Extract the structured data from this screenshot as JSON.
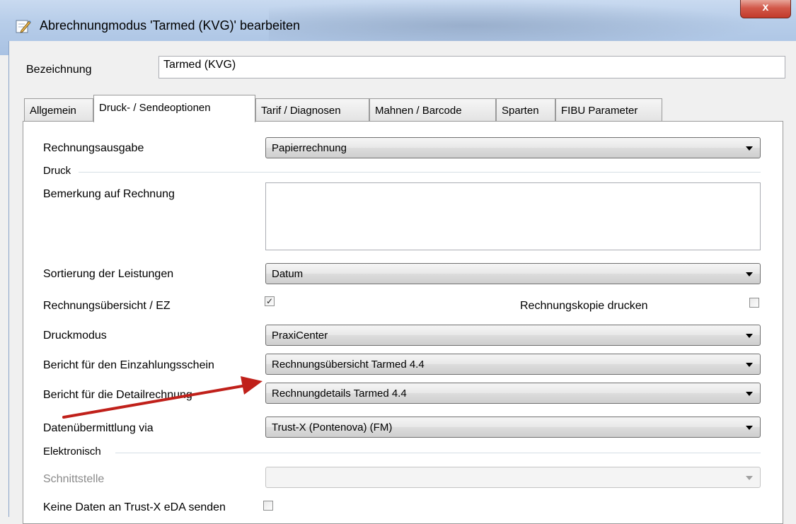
{
  "window": {
    "title": "Abrechnungmodus 'Tarmed (KVG)' bearbeiten",
    "close_label": "x"
  },
  "header": {
    "bezeichnung_label": "Bezeichnung",
    "bezeichnung_value": "Tarmed (KVG)"
  },
  "tabs": [
    {
      "label": "Allgemein"
    },
    {
      "label": "Druck- / Sendeoptionen"
    },
    {
      "label": "Tarif / Diagnosen"
    },
    {
      "label": "Mahnen / Barcode"
    },
    {
      "label": "Sparten"
    },
    {
      "label": "FIBU Parameter"
    }
  ],
  "form": {
    "rechnungsausgabe_label": "Rechnungsausgabe",
    "rechnungsausgabe_value": "Papierrechnung",
    "druck_group": "Druck",
    "bemerkung_label": "Bemerkung auf Rechnung",
    "bemerkung_value": "",
    "sortierung_label": "Sortierung der Leistungen",
    "sortierung_value": "Datum",
    "rechnungsuebersicht_label": "Rechnungsübersicht / EZ",
    "rechnungsuebersicht_checked": true,
    "rechnungskopie_label": "Rechnungskopie drucken",
    "rechnungskopie_checked": false,
    "druckmodus_label": "Druckmodus",
    "druckmodus_value": "PraxiCenter",
    "bericht_ez_label": "Bericht für den Einzahlungsschein",
    "bericht_ez_value": "Rechnungsübersicht Tarmed 4.4",
    "bericht_detail_label": "Bericht für die Detailrechnung",
    "bericht_detail_value": "Rechnungdetails Tarmed 4.4",
    "datenuebermittlung_label": "Datenübermittlung via",
    "datenuebermittlung_value": "Trust-X (Pontenova) (FM)",
    "elektronisch_group": "Elektronisch",
    "schnittstelle_label": "Schnittstelle",
    "schnittstelle_value": "",
    "keine_daten_label": "Keine Daten an Trust-X eDA senden",
    "keine_daten_checked": false
  },
  "colors": {
    "annotation_arrow": "#c0201a",
    "disabled_text": "#8a8a8a"
  },
  "check_mark": "✓"
}
